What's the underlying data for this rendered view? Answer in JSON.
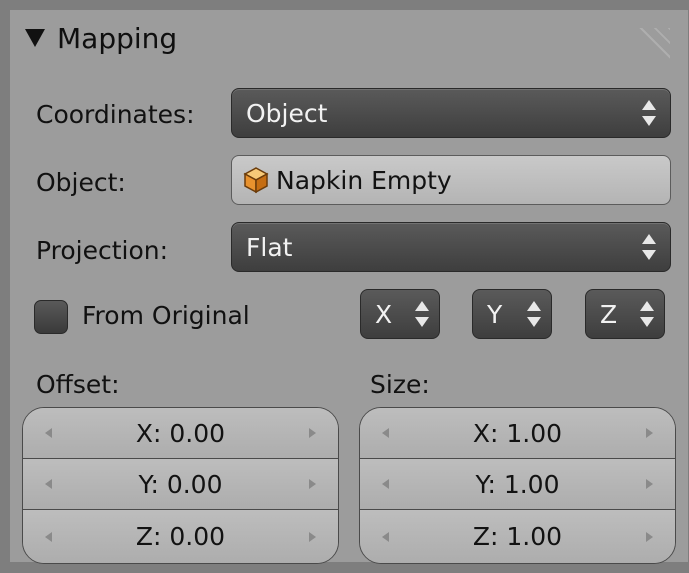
{
  "panel": {
    "title": "Mapping"
  },
  "coordinates": {
    "label": "Coordinates:",
    "value": "Object"
  },
  "object": {
    "label": "Object:",
    "value": "Napkin Empty",
    "icon": "cube-icon"
  },
  "projection": {
    "label": "Projection:",
    "value": "Flat"
  },
  "from_original": {
    "label": "From Original",
    "checked": false
  },
  "axes": {
    "x": "X",
    "y": "Y",
    "z": "Z"
  },
  "offset": {
    "label": "Offset:",
    "x": "X: 0.00",
    "y": "Y: 0.00",
    "z": "Z: 0.00"
  },
  "size": {
    "label": "Size:",
    "x": "X: 1.00",
    "y": "Y: 1.00",
    "z": "Z: 1.00"
  }
}
